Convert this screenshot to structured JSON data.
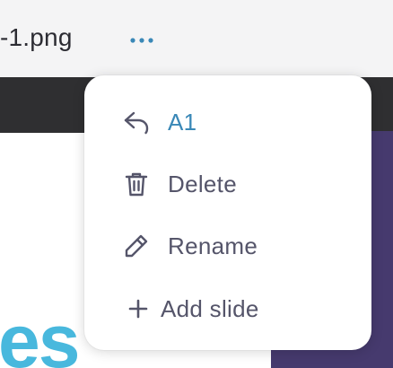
{
  "header": {
    "filename": "-1.png",
    "more_icon": "more-horizontal-icon",
    "accent_color": "#3a88b7"
  },
  "canvas": {
    "big_text": "es",
    "panel_color": "#463a6e",
    "text_color": "#48b8dd"
  },
  "menu": {
    "items": [
      {
        "label": "A1",
        "icon": "reply-arrow-icon"
      },
      {
        "label": "Delete",
        "icon": "trash-icon"
      },
      {
        "label": "Rename",
        "icon": "pencil-icon"
      },
      {
        "label": "Add slide",
        "icon": "plus-icon"
      }
    ]
  }
}
